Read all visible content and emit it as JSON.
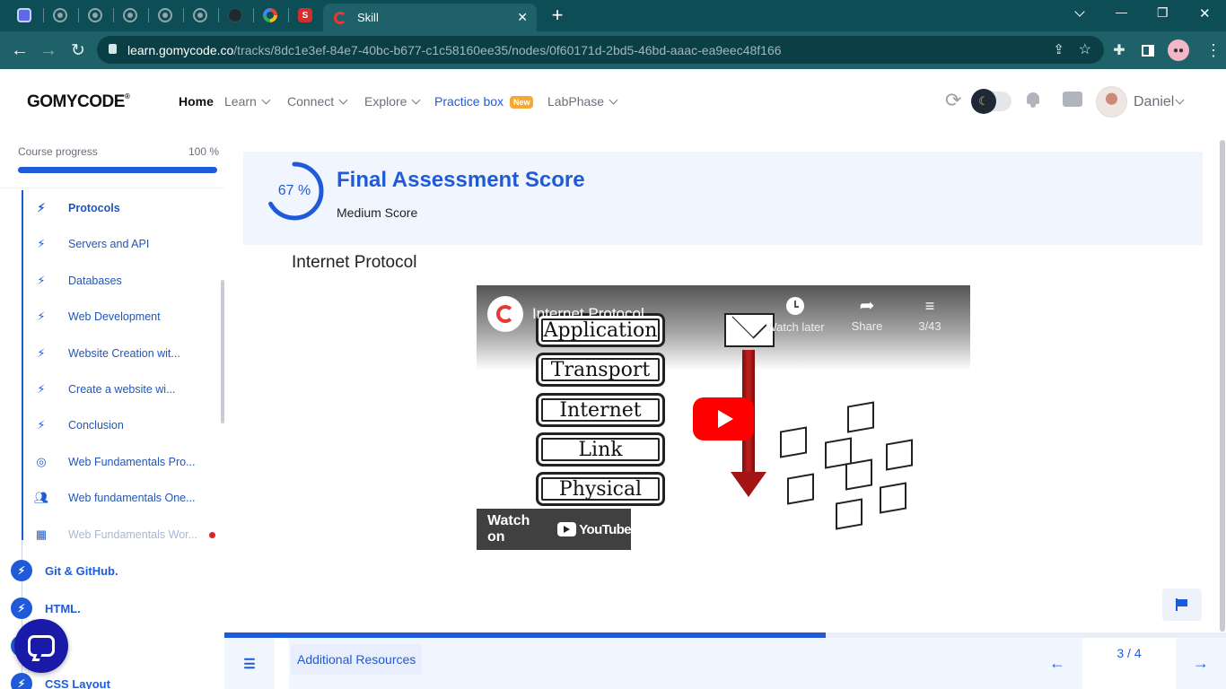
{
  "browser": {
    "active_tab_title": "Skill",
    "url_domain": "learn.gomycode.co",
    "url_path": "/tracks/8dc1e3ef-84e7-40bc-b677-c1c58160ee35/nodes/0f60171d-2bd5-46bd-aaac-ea9eec48f166",
    "new_tab_glyph": "+",
    "window_buttons": {
      "minimize": "—",
      "restore": "❐",
      "close": "✕"
    }
  },
  "header": {
    "logo": "GOMYCODE",
    "nav": [
      {
        "label": "Home",
        "active": true
      },
      {
        "label": "Learn",
        "dropdown": true
      },
      {
        "label": "Connect",
        "dropdown": true
      },
      {
        "label": "Explore",
        "dropdown": true
      },
      {
        "label": "Practice box",
        "badge": "New",
        "highlight": true
      },
      {
        "label": "LabPhase",
        "dropdown": true
      }
    ],
    "user_name": "Daniel",
    "dark_mode_icon": "moon-icon"
  },
  "sidebar": {
    "progress_label": "Course progress",
    "progress_value": "100 %",
    "progress_fraction": 1.0,
    "items": [
      {
        "label": "Protocols",
        "icon": "bolt-icon",
        "bold": true
      },
      {
        "label": "Servers and API",
        "icon": "bolt-icon"
      },
      {
        "label": "Databases",
        "icon": "bolt-icon"
      },
      {
        "label": "Web Development",
        "icon": "bolt-icon"
      },
      {
        "label": "Website Creation wit...",
        "icon": "bolt-icon"
      },
      {
        "label": "Create a website wi...",
        "icon": "bolt-icon"
      },
      {
        "label": "Conclusion",
        "icon": "bolt-icon"
      },
      {
        "label": "Web Fundamentals Pro...",
        "icon": "target-icon"
      },
      {
        "label": "Web fundamentals One...",
        "icon": "people-icon"
      },
      {
        "label": "Web Fundamentals Wor...",
        "icon": "workshop-icon",
        "faded": true,
        "dot": true
      }
    ],
    "sections": [
      {
        "label": "Git & GitHub."
      },
      {
        "label": "HTML."
      },
      {
        "label": "."
      },
      {
        "label": "CSS Layout"
      }
    ]
  },
  "main": {
    "score_percent": 67,
    "score_text": "67 %",
    "score_title": "Final Assessment Score",
    "score_subtitle": "Medium Score",
    "lesson_title": "Internet Protocol",
    "video": {
      "title": "Internet Protocol",
      "watch_later": "Watch later",
      "share": "Share",
      "playlist_count": "3/43",
      "watch_on": "Watch on",
      "youtube": "YouTube",
      "layers": [
        "Application",
        "Transport",
        "Internet",
        "Link",
        "Physical"
      ]
    },
    "slide_progress_fraction": 0.6,
    "additional_resources": "Additional Resources",
    "pagination": "3 / 4"
  },
  "colors": {
    "accent": "#1f5bd8",
    "chrome_dark": "#0d4d56",
    "chrome_mid": "#1e6168",
    "card_bg": "#f1f6fe",
    "chat_button": "#1a1aa8"
  }
}
